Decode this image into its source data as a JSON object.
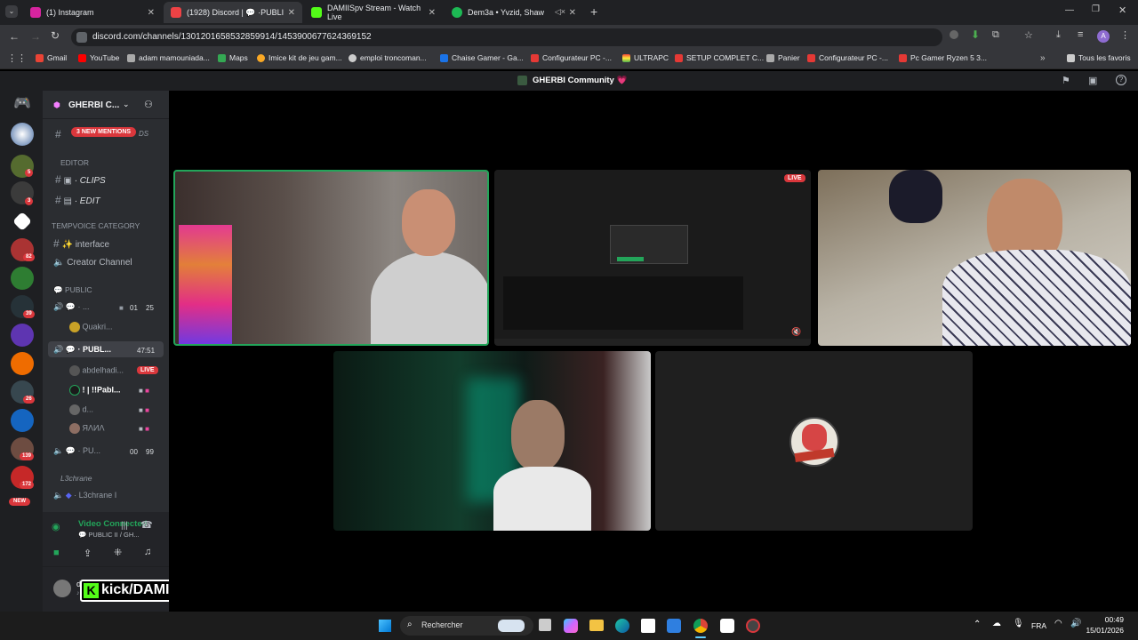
{
  "tabs": [
    {
      "title": "(1) Instagram",
      "fav": "#d6249f"
    },
    {
      "title": "(1928) Discord | 💬 ·PUBLI",
      "fav": "#ed4245"
    },
    {
      "title": "DAMIISpv Stream - Watch Live",
      "fav": "#53fc18"
    },
    {
      "title": "Dem3a • Yvzid, Shaw",
      "fav": "#1db954"
    }
  ],
  "url": "discord.com/channels/1301201658532859914/1453900677624369152",
  "bookmarks": [
    "Gmail",
    "YouTube",
    "adam mamouniada...",
    "Maps",
    "Imice kit de jeu gam...",
    "emploi troncoman...",
    "Chaise Gamer - Ga...",
    "Configurateur PC -...",
    "ULTRAPC",
    "SETUP COMPLET C...",
    "Panier",
    "Configurateur PC -...",
    "Pc Gamer Ryzen 5 3...",
    "Tous les favoris"
  ],
  "server_title": "GHERBI Community 💗",
  "server_name": "GHERBI C...",
  "mentions": "3 NEW MENTIONS",
  "channels": {
    "hidden_suffix": "DS",
    "editor_cat": "EDITOR",
    "clips": "· CLIPS",
    "edit": "· EDIT",
    "tempvoice_cat": "TEMPVOICE CATEGORY",
    "interface": "interface",
    "creator": "Creator Channel",
    "public_cat": "PUBLIC",
    "vc1": "· ...",
    "vc1_a": "01",
    "vc1_b": "25",
    "quakri": "Quakri...",
    "publ": "· PUBL...",
    "publ_timer": "47:51",
    "u1": "abdelhadi...",
    "live": "LIVE",
    "u2": "! | !!Pabl...",
    "u3": "d...",
    "u4": "ЯΛИΛ",
    "pu": "· PU...",
    "pu_a": "00",
    "pu_b": "99",
    "l3_cat": "L3chrane",
    "l3": "· L3chrane I"
  },
  "rail_badges": [
    "5",
    "3",
    "82",
    "39",
    "26",
    "139",
    "172",
    "NEW"
  ],
  "voice": {
    "status": "Video Connected",
    "sub": "💬 PUBLIC II / GH..."
  },
  "user": {
    "name": "d...",
    "overlay": "kick/DAMIISpv"
  },
  "live_badge": "LIVE",
  "taskbar": {
    "search": "Rechercher",
    "lang": "FRA",
    "time": "00:49",
    "date": "15/01/2026"
  }
}
